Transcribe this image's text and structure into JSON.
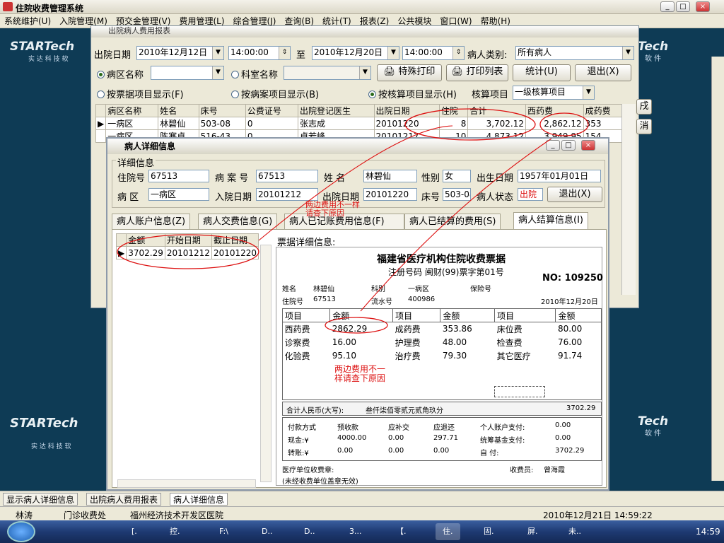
{
  "app": {
    "title": "住院收费管理系统",
    "window_buttons": [
      "_",
      "□",
      "×"
    ]
  },
  "menu": [
    "系统维护(U)",
    "入院管理(M)",
    "预交金管理(V)",
    "费用管理(L)",
    "综合管理(J)",
    "查询(B)",
    "统计(T)",
    "报表(Z)",
    "公共模块",
    "窗口(W)",
    "帮助(H)"
  ],
  "brand": {
    "logo_left": "STARTech",
    "logo_sub": "实 达 科 技 软",
    "logo_right": "Tech",
    "logo_right_sub": "软 件"
  },
  "report": {
    "title": "出院病人费用报表",
    "date_label": "出院日期",
    "date_from": "2010年12月12日",
    "time_from": "14:00:00",
    "to": "至",
    "date_to": "2010年12月20日",
    "time_to": "14:00:00",
    "patient_type_label": "病人类别:",
    "patient_type": "所有病人",
    "radio_ward": "病区名称",
    "radio_dept": "科室名称",
    "btn_special_print": "特殊打印",
    "btn_print_list": "打印列表",
    "btn_stats": "统计(U)",
    "btn_exit": "退出(X)",
    "radio_bill": "按票据项目显示(F)",
    "radio_case": "按病案项目显示(B)",
    "radio_acct": "按核算项目显示(H)",
    "acct_label": "核算项目",
    "acct_value": "一级核算项目",
    "columns": [
      "病区名称",
      "姓名",
      "床号",
      "公费证号",
      "出院登记医生",
      "出院日期",
      "住院",
      "合计",
      "西药费",
      "成药费"
    ],
    "rows": [
      [
        "一病区",
        "林碧仙",
        "503-08",
        "0",
        "张志成",
        "20101220",
        "8",
        "3,702.12",
        "2,862.12",
        "353"
      ],
      [
        "一病区",
        "陈寒卓",
        "516-43",
        "0",
        "卓若峰",
        "20101217",
        "10",
        "4,873.12",
        "3,949.95",
        "154"
      ]
    ],
    "side_btns": [
      "戌",
      "消"
    ]
  },
  "detail": {
    "title": "病人详细信息",
    "group": "详细信息",
    "fields": {
      "inp_no_label": "住院号",
      "inp_no": "67513",
      "case_no_label": "病 案 号",
      "case_no": "67513",
      "name_label": "姓 名",
      "name": "林碧仙",
      "sex_label": "性别",
      "sex": "女",
      "birth_label": "出生日期",
      "birth": "1957年01月01日",
      "ward_label": "病 区",
      "ward": "一病区",
      "admit_label": "入院日期",
      "admit": "20101212",
      "discharge_label": "出院日期",
      "discharge": "20101220",
      "bed_label": "床号",
      "bed": "503-08",
      "status_label": "病人状态",
      "status": "出院"
    },
    "exit_btn": "退出(X)",
    "tabs": [
      "病人账户信息(Z)",
      "病人交费信息(G)",
      "病人已记账费用信息(F)",
      "病人已结算的费用(S)",
      "病人结算信息(I)"
    ],
    "left_cols": [
      "金额",
      "开始日期",
      "截止日期"
    ],
    "left_row": [
      "3702.29",
      "20101212",
      "20101220"
    ],
    "bill_label": "票据详细信息:",
    "annotation": "两边费用不一样请查下原因"
  },
  "bill": {
    "title": "福建省医疗机构住院收费票据",
    "reg": "注册号码 闽财(99)票字第01号",
    "no": "NO: 109250",
    "name_label": "姓名",
    "name": "林碧仙",
    "dept_label": "科别",
    "dept": "一病区",
    "ins_label": "保险号",
    "inp_label": "住院号",
    "inp": "67513",
    "serial_label": "流水号",
    "serial": "400986",
    "date": "2010年12月20日",
    "head": [
      "项目",
      "金额",
      "项目",
      "金额",
      "项目",
      "金额"
    ],
    "rows": [
      [
        "西药费",
        "2862.29",
        "成药费",
        "353.86",
        "床位费",
        "80.00"
      ],
      [
        "诊察费",
        "16.00",
        "护理费",
        "48.00",
        "检查费",
        "76.00"
      ],
      [
        "化验费",
        "95.10",
        "治疗费",
        "79.30",
        "其它医疗",
        "91.74"
      ]
    ],
    "total_label": "合计人民币(大写):",
    "total_words": "叁仟柒佰零贰元贰角玖分",
    "total": "3702.29",
    "pay_head": [
      "付款方式",
      "预收款",
      "应补交",
      "应退还",
      "个人账户支付:",
      "0.00"
    ],
    "cash": [
      "现金:¥",
      "4000.00",
      "0.00",
      "297.71",
      "统筹基金支付:",
      "0.00"
    ],
    "transfer": [
      "转账:¥",
      "0.00",
      "0.00",
      "0.00",
      "自 付:",
      "3702.29"
    ],
    "seal": "医疗单位收费章:",
    "cashier_label": "收费员:",
    "cashier": "曾海霞",
    "note": "(未经收费单位盖章无效)"
  },
  "wintabs": [
    "显示病人详细信息",
    "出院病人费用报表",
    "病人详细信息"
  ],
  "status": [
    "林涛",
    "门诊收费处",
    "福州经济技术开发区医院",
    "2010年12月21日 14:59:22"
  ],
  "taskbar": {
    "items": [
      "[.",
      "控.",
      "F:\\",
      "D..",
      "D..",
      "3...",
      "【.",
      "住.",
      "固.",
      "屏.",
      "未.."
    ],
    "clock": "14:59"
  }
}
